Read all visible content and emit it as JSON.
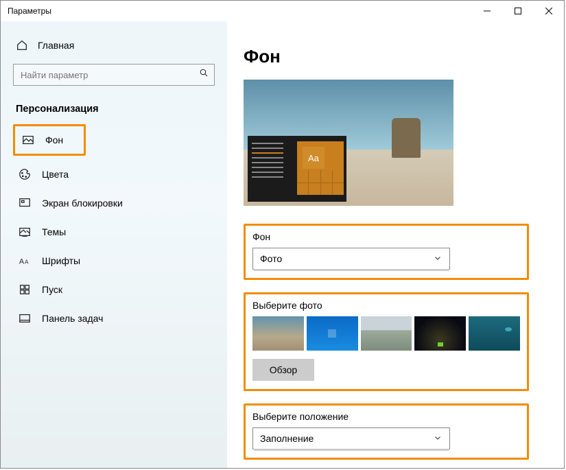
{
  "window": {
    "title": "Параметры"
  },
  "sidebar": {
    "home": "Главная",
    "search_placeholder": "Найти параметр",
    "section": "Персонализация",
    "items": [
      {
        "label": "Фон"
      },
      {
        "label": "Цвета"
      },
      {
        "label": "Экран блокировки"
      },
      {
        "label": "Темы"
      },
      {
        "label": "Шрифты"
      },
      {
        "label": "Пуск"
      },
      {
        "label": "Панель задач"
      }
    ]
  },
  "main": {
    "title": "Фон",
    "preview_sample": "Aa",
    "background_section": {
      "label": "Фон",
      "selected": "Фото"
    },
    "photo_section": {
      "label": "Выберите фото",
      "browse": "Обзор"
    },
    "position_section": {
      "label": "Выберите положение",
      "selected": "Заполнение"
    }
  }
}
